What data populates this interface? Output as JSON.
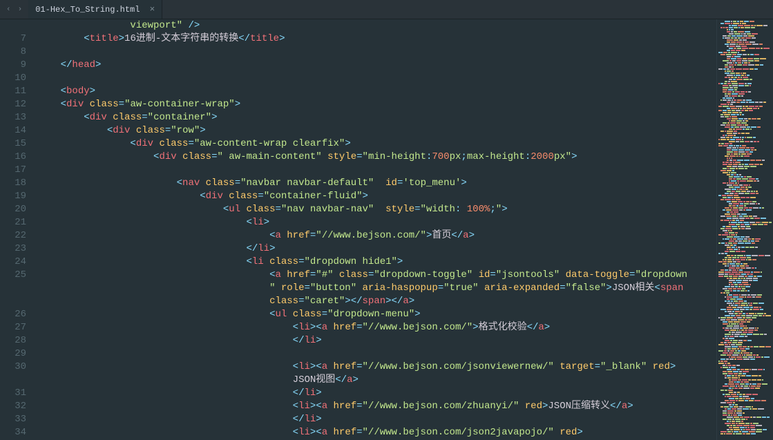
{
  "tab": {
    "filename": "01-Hex_To_String.html",
    "close": "×"
  },
  "nav": {
    "back": "‹",
    "forward": "›"
  },
  "lines": [
    {
      "n": "",
      "ind": 16,
      "seg": [
        [
          "tx",
          "viewport\" />"
        ]
      ],
      "tokens": [
        [
          "s",
          "viewport\""
        ],
        [
          "tx",
          " "
        ],
        [
          "p",
          "/>"
        ]
      ]
    },
    {
      "n": "7",
      "ind": 8,
      "tokens": [
        [
          "p",
          "<"
        ],
        [
          "tg",
          "title"
        ],
        [
          "p",
          ">"
        ],
        [
          "tx",
          "16进制-文本字符串的转换"
        ],
        [
          "p",
          "</"
        ],
        [
          "tg",
          "title"
        ],
        [
          "p",
          ">"
        ]
      ]
    },
    {
      "n": "8",
      "ind": 0,
      "tokens": []
    },
    {
      "n": "9",
      "ind": 4,
      "tokens": [
        [
          "p",
          "</"
        ],
        [
          "tg",
          "head"
        ],
        [
          "p",
          ">"
        ]
      ]
    },
    {
      "n": "10",
      "ind": 0,
      "tokens": []
    },
    {
      "n": "11",
      "ind": 4,
      "tokens": [
        [
          "p",
          "<"
        ],
        [
          "tg",
          "body"
        ],
        [
          "p",
          ">"
        ]
      ]
    },
    {
      "n": "12",
      "ind": 4,
      "tokens": [
        [
          "p",
          "<"
        ],
        [
          "tg",
          "div"
        ],
        [
          "tx",
          " "
        ],
        [
          "an",
          "class"
        ],
        [
          "p",
          "="
        ],
        [
          "s",
          "\"aw-container-wrap\""
        ],
        [
          "p",
          ">"
        ]
      ]
    },
    {
      "n": "13",
      "ind": 8,
      "tokens": [
        [
          "p",
          "<"
        ],
        [
          "tg",
          "div"
        ],
        [
          "tx",
          " "
        ],
        [
          "an",
          "class"
        ],
        [
          "p",
          "="
        ],
        [
          "s",
          "\"container\""
        ],
        [
          "p",
          ">"
        ]
      ]
    },
    {
      "n": "14",
      "ind": 12,
      "tokens": [
        [
          "p",
          "<"
        ],
        [
          "tg",
          "div"
        ],
        [
          "tx",
          " "
        ],
        [
          "an",
          "class"
        ],
        [
          "p",
          "="
        ],
        [
          "s",
          "\"row\""
        ],
        [
          "p",
          ">"
        ]
      ]
    },
    {
      "n": "15",
      "ind": 16,
      "tokens": [
        [
          "p",
          "<"
        ],
        [
          "tg",
          "div"
        ],
        [
          "tx",
          " "
        ],
        [
          "an",
          "class"
        ],
        [
          "p",
          "="
        ],
        [
          "s",
          "\"aw-content-wrap clearfix\""
        ],
        [
          "p",
          ">"
        ]
      ]
    },
    {
      "n": "16",
      "ind": 20,
      "tokens": [
        [
          "p",
          "<"
        ],
        [
          "tg",
          "div"
        ],
        [
          "tx",
          " "
        ],
        [
          "an",
          "class"
        ],
        [
          "p",
          "="
        ],
        [
          "s",
          "\" aw-main-content\""
        ],
        [
          "tx",
          " "
        ],
        [
          "an",
          "style"
        ],
        [
          "p",
          "="
        ],
        [
          "s",
          "\""
        ],
        [
          "kw",
          "min-height"
        ],
        [
          "p",
          ":"
        ],
        [
          "nm",
          "700"
        ],
        [
          "s",
          "px"
        ],
        [
          "p",
          ";"
        ],
        [
          "kw",
          "max-height"
        ],
        [
          "p",
          ":"
        ],
        [
          "nm",
          "2000"
        ],
        [
          "s",
          "px"
        ],
        [
          "s",
          "\""
        ],
        [
          "p",
          ">"
        ]
      ]
    },
    {
      "n": "17",
      "ind": 0,
      "tokens": []
    },
    {
      "n": "18",
      "ind": 24,
      "tokens": [
        [
          "p",
          "<"
        ],
        [
          "tg",
          "nav"
        ],
        [
          "tx",
          " "
        ],
        [
          "an",
          "class"
        ],
        [
          "p",
          "="
        ],
        [
          "s",
          "\"navbar navbar-default\""
        ],
        [
          "tx",
          "  "
        ],
        [
          "an",
          "id"
        ],
        [
          "p",
          "="
        ],
        [
          "s",
          "'top_menu'"
        ],
        [
          "p",
          ">"
        ]
      ]
    },
    {
      "n": "19",
      "ind": 28,
      "tokens": [
        [
          "p",
          "<"
        ],
        [
          "tg",
          "div"
        ],
        [
          "tx",
          " "
        ],
        [
          "an",
          "class"
        ],
        [
          "p",
          "="
        ],
        [
          "s",
          "\"container-fluid\""
        ],
        [
          "p",
          ">"
        ]
      ]
    },
    {
      "n": "20",
      "ind": 32,
      "tokens": [
        [
          "p",
          "<"
        ],
        [
          "tg",
          "ul"
        ],
        [
          "tx",
          " "
        ],
        [
          "an",
          "class"
        ],
        [
          "p",
          "="
        ],
        [
          "s",
          "\"nav navbar-nav\""
        ],
        [
          "tx",
          "  "
        ],
        [
          "an",
          "style"
        ],
        [
          "p",
          "="
        ],
        [
          "s",
          "\""
        ],
        [
          "kw",
          "width"
        ],
        [
          "p",
          ": "
        ],
        [
          "nm",
          "100%"
        ],
        [
          "p",
          ";"
        ],
        [
          "s",
          "\""
        ],
        [
          "p",
          ">"
        ]
      ]
    },
    {
      "n": "21",
      "ind": 36,
      "tokens": [
        [
          "p",
          "<"
        ],
        [
          "tg",
          "li"
        ],
        [
          "p",
          ">"
        ]
      ]
    },
    {
      "n": "22",
      "ind": 40,
      "tokens": [
        [
          "p",
          "<"
        ],
        [
          "tg",
          "a"
        ],
        [
          "tx",
          " "
        ],
        [
          "an",
          "href"
        ],
        [
          "p",
          "="
        ],
        [
          "s",
          "\"//www.bejson.com/\""
        ],
        [
          "p",
          ">"
        ],
        [
          "tx",
          "首页"
        ],
        [
          "p",
          "</"
        ],
        [
          "tg",
          "a"
        ],
        [
          "p",
          ">"
        ]
      ]
    },
    {
      "n": "23",
      "ind": 36,
      "tokens": [
        [
          "p",
          "</"
        ],
        [
          "tg",
          "li"
        ],
        [
          "p",
          ">"
        ]
      ]
    },
    {
      "n": "24",
      "ind": 36,
      "tokens": [
        [
          "p",
          "<"
        ],
        [
          "tg",
          "li"
        ],
        [
          "tx",
          " "
        ],
        [
          "an",
          "class"
        ],
        [
          "p",
          "="
        ],
        [
          "s",
          "\"dropdown hide1\""
        ],
        [
          "p",
          ">"
        ]
      ]
    },
    {
      "n": "25",
      "ind": 40,
      "tokens": [
        [
          "p",
          "<"
        ],
        [
          "tg",
          "a"
        ],
        [
          "tx",
          " "
        ],
        [
          "an",
          "href"
        ],
        [
          "p",
          "="
        ],
        [
          "s",
          "\"#\""
        ],
        [
          "tx",
          " "
        ],
        [
          "an",
          "class"
        ],
        [
          "p",
          "="
        ],
        [
          "s",
          "\"dropdown-toggle\""
        ],
        [
          "tx",
          " "
        ],
        [
          "an",
          "id"
        ],
        [
          "p",
          "="
        ],
        [
          "s",
          "\"jsontools\""
        ],
        [
          "tx",
          " "
        ],
        [
          "an",
          "data-toggle"
        ],
        [
          "p",
          "="
        ],
        [
          "s",
          "\"dropdown"
        ]
      ]
    },
    {
      "n": "",
      "ind": 40,
      "tokens": [
        [
          "s",
          "\""
        ],
        [
          "tx",
          " "
        ],
        [
          "an",
          "role"
        ],
        [
          "p",
          "="
        ],
        [
          "s",
          "\"button\""
        ],
        [
          "tx",
          " "
        ],
        [
          "an",
          "aria-haspopup"
        ],
        [
          "p",
          "="
        ],
        [
          "s",
          "\"true\""
        ],
        [
          "tx",
          " "
        ],
        [
          "an",
          "aria-expanded"
        ],
        [
          "p",
          "="
        ],
        [
          "s",
          "\"false\""
        ],
        [
          "p",
          ">"
        ],
        [
          "tx",
          "JSON相关"
        ],
        [
          "p",
          "<"
        ],
        [
          "tg",
          "span"
        ]
      ]
    },
    {
      "n": "",
      "ind": 40,
      "tokens": [
        [
          "an",
          "class"
        ],
        [
          "p",
          "="
        ],
        [
          "s",
          "\"caret\""
        ],
        [
          "p",
          "></"
        ],
        [
          "tg",
          "span"
        ],
        [
          "p",
          "></"
        ],
        [
          "tg",
          "a"
        ],
        [
          "p",
          ">"
        ]
      ]
    },
    {
      "n": "26",
      "ind": 40,
      "tokens": [
        [
          "p",
          "<"
        ],
        [
          "tg",
          "ul"
        ],
        [
          "tx",
          " "
        ],
        [
          "an",
          "class"
        ],
        [
          "p",
          "="
        ],
        [
          "s",
          "\"dropdown-menu\""
        ],
        [
          "p",
          ">"
        ]
      ]
    },
    {
      "n": "27",
      "ind": 44,
      "tokens": [
        [
          "p",
          "<"
        ],
        [
          "tg",
          "li"
        ],
        [
          "p",
          "><"
        ],
        [
          "tg",
          "a"
        ],
        [
          "tx",
          " "
        ],
        [
          "an",
          "href"
        ],
        [
          "p",
          "="
        ],
        [
          "s",
          "\"//www.bejson.com/\""
        ],
        [
          "p",
          ">"
        ],
        [
          "tx",
          "格式化校验"
        ],
        [
          "p",
          "</"
        ],
        [
          "tg",
          "a"
        ],
        [
          "p",
          ">"
        ]
      ]
    },
    {
      "n": "28",
      "ind": 44,
      "tokens": [
        [
          "p",
          "</"
        ],
        [
          "tg",
          "li"
        ],
        [
          "p",
          ">"
        ]
      ]
    },
    {
      "n": "29",
      "ind": 0,
      "tokens": []
    },
    {
      "n": "30",
      "ind": 44,
      "tokens": [
        [
          "p",
          "<"
        ],
        [
          "tg",
          "li"
        ],
        [
          "p",
          "><"
        ],
        [
          "tg",
          "a"
        ],
        [
          "tx",
          " "
        ],
        [
          "an",
          "href"
        ],
        [
          "p",
          "="
        ],
        [
          "s",
          "\"//www.bejson.com/jsonviewernew/\""
        ],
        [
          "tx",
          " "
        ],
        [
          "an",
          "target"
        ],
        [
          "p",
          "="
        ],
        [
          "s",
          "\"_blank\""
        ],
        [
          "tx",
          " "
        ],
        [
          "an",
          "red"
        ],
        [
          "p",
          ">"
        ]
      ]
    },
    {
      "n": "",
      "ind": 44,
      "tokens": [
        [
          "tx",
          "JSON视图"
        ],
        [
          "p",
          "</"
        ],
        [
          "tg",
          "a"
        ],
        [
          "p",
          ">"
        ]
      ]
    },
    {
      "n": "31",
      "ind": 44,
      "tokens": [
        [
          "p",
          "</"
        ],
        [
          "tg",
          "li"
        ],
        [
          "p",
          ">"
        ]
      ]
    },
    {
      "n": "32",
      "ind": 44,
      "tokens": [
        [
          "p",
          "<"
        ],
        [
          "tg",
          "li"
        ],
        [
          "p",
          "><"
        ],
        [
          "tg",
          "a"
        ],
        [
          "tx",
          " "
        ],
        [
          "an",
          "href"
        ],
        [
          "p",
          "="
        ],
        [
          "s",
          "\"//www.bejson.com/zhuanyi/\""
        ],
        [
          "tx",
          " "
        ],
        [
          "an",
          "red"
        ],
        [
          "p",
          ">"
        ],
        [
          "tx",
          "JSON压缩转义"
        ],
        [
          "p",
          "</"
        ],
        [
          "tg",
          "a"
        ],
        [
          "p",
          ">"
        ]
      ]
    },
    {
      "n": "33",
      "ind": 44,
      "tokens": [
        [
          "p",
          "</"
        ],
        [
          "tg",
          "li"
        ],
        [
          "p",
          ">"
        ]
      ]
    },
    {
      "n": "34",
      "ind": 44,
      "tokens": [
        [
          "p",
          "<"
        ],
        [
          "tg",
          "li"
        ],
        [
          "p",
          "><"
        ],
        [
          "tg",
          "a"
        ],
        [
          "tx",
          " "
        ],
        [
          "an",
          "href"
        ],
        [
          "p",
          "="
        ],
        [
          "s",
          "\"//www.bejson.com/json2javapojo/\""
        ],
        [
          "tx",
          " "
        ],
        [
          "an",
          "red"
        ],
        [
          "p",
          ">"
        ]
      ]
    }
  ],
  "minimap_colors": [
    "#89ddff",
    "#f07178",
    "#ffcb6b",
    "#c3e88d",
    "#d5ced9",
    "#f78c6c"
  ]
}
